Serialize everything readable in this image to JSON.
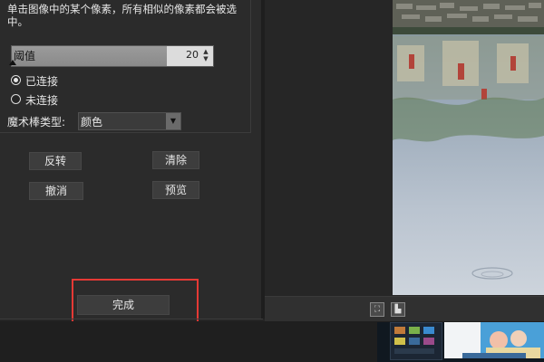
{
  "options": {
    "description": "单击图像中的某个像素，所有相似的像素都会被选中。",
    "threshold": {
      "label": "阈值",
      "value": "20",
      "fraction": 0.77
    },
    "radios": [
      {
        "label": "已连接",
        "checked": true
      },
      {
        "label": "未连接",
        "checked": false
      }
    ],
    "wand_type": {
      "label": "魔术棒类型:",
      "value": "颜色"
    }
  },
  "buttons": {
    "invert": "反转",
    "clear": "清除",
    "undo": "撤消",
    "preview": "预览",
    "done": "完成"
  },
  "colors": {
    "highlight": "#e53935",
    "panel": "#2b2b2b",
    "button": "#3d3d3d"
  },
  "icons": [
    "fit-screen-icon",
    "histogram-icon",
    "stepper-icon",
    "dropdown-arrow-icon"
  ]
}
